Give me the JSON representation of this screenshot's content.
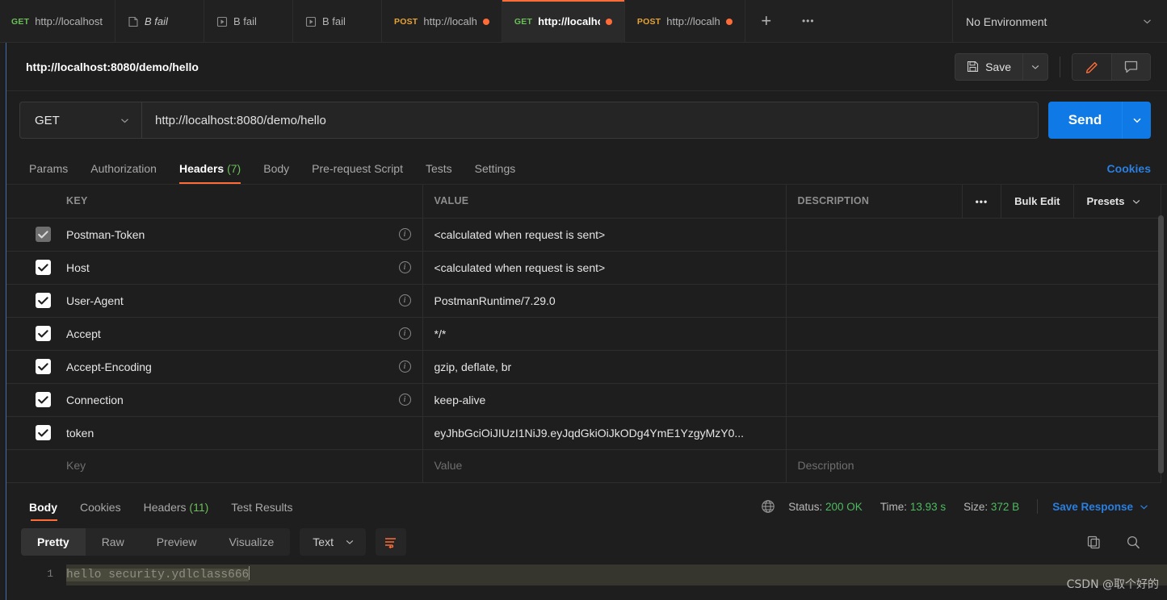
{
  "tabbar": {
    "tabs": [
      {
        "method": "GET",
        "method_class": "m-get",
        "label": "http://localhost",
        "icon": "",
        "dirty": false,
        "active": false,
        "italic": false
      },
      {
        "method": "",
        "method_class": "",
        "label": "B fail",
        "icon": "document-icon",
        "dirty": false,
        "active": false,
        "italic": true
      },
      {
        "method": "",
        "method_class": "",
        "label": "B fail",
        "icon": "runner-icon",
        "dirty": false,
        "active": false,
        "italic": false
      },
      {
        "method": "",
        "method_class": "",
        "label": "B fail",
        "icon": "runner-icon",
        "dirty": false,
        "active": false,
        "italic": false
      },
      {
        "method": "POST",
        "method_class": "m-post",
        "label": "http://localh",
        "icon": "",
        "dirty": true,
        "active": false,
        "italic": false
      },
      {
        "method": "GET",
        "method_class": "m-get",
        "label": "http://localho",
        "icon": "",
        "dirty": true,
        "active": true,
        "italic": false
      },
      {
        "method": "POST",
        "method_class": "m-post",
        "label": "http://localh",
        "icon": "",
        "dirty": true,
        "active": false,
        "italic": false
      }
    ],
    "new_tab_label": "+",
    "more_label": "•••",
    "environment": "No Environment"
  },
  "request": {
    "title": "http://localhost:8080/demo/hello",
    "save_label": "Save",
    "method": "GET",
    "url": "http://localhost:8080/demo/hello",
    "send_label": "Send"
  },
  "request_tabs": [
    {
      "label": "Params",
      "count": "",
      "active": false
    },
    {
      "label": "Authorization",
      "count": "",
      "active": false
    },
    {
      "label": "Headers",
      "count": "(7)",
      "active": true
    },
    {
      "label": "Body",
      "count": "",
      "active": false
    },
    {
      "label": "Pre-request Script",
      "count": "",
      "active": false
    },
    {
      "label": "Tests",
      "count": "",
      "active": false
    },
    {
      "label": "Settings",
      "count": "",
      "active": false
    }
  ],
  "cookies_link": "Cookies",
  "headers_table": {
    "columns": [
      "KEY",
      "VALUE",
      "DESCRIPTION"
    ],
    "actions": {
      "more": "•••",
      "bulk_edit": "Bulk Edit",
      "presets": "Presets"
    },
    "rows": [
      {
        "checked": true,
        "disabled": true,
        "key": "Postman-Token",
        "info": true,
        "value": "<calculated when request is sent>",
        "description": ""
      },
      {
        "checked": true,
        "disabled": false,
        "key": "Host",
        "info": true,
        "value": "<calculated when request is sent>",
        "description": ""
      },
      {
        "checked": true,
        "disabled": false,
        "key": "User-Agent",
        "info": true,
        "value": "PostmanRuntime/7.29.0",
        "description": ""
      },
      {
        "checked": true,
        "disabled": false,
        "key": "Accept",
        "info": true,
        "value": "*/*",
        "description": ""
      },
      {
        "checked": true,
        "disabled": false,
        "key": "Accept-Encoding",
        "info": true,
        "value": "gzip, deflate, br",
        "description": ""
      },
      {
        "checked": true,
        "disabled": false,
        "key": "Connection",
        "info": true,
        "value": "keep-alive",
        "description": ""
      },
      {
        "checked": true,
        "disabled": false,
        "key": "token",
        "info": false,
        "value": "eyJhbGciOiJIUzI1NiJ9.eyJqdGkiOiJkODg4YmE1YzgyMzY0...",
        "description": ""
      }
    ],
    "new_row": {
      "key_placeholder": "Key",
      "value_placeholder": "Value",
      "description_placeholder": "Description"
    }
  },
  "response_tabs": [
    {
      "label": "Body",
      "count": "",
      "active": true
    },
    {
      "label": "Cookies",
      "count": "",
      "active": false
    },
    {
      "label": "Headers",
      "count": "(11)",
      "active": false
    },
    {
      "label": "Test Results",
      "count": "",
      "active": false
    }
  ],
  "response_status": {
    "status_label": "Status:",
    "status_value": "200 OK",
    "time_label": "Time:",
    "time_value": "13.93 s",
    "size_label": "Size:",
    "size_value": "372 B",
    "save_response": "Save Response"
  },
  "body_toolbar": {
    "views": [
      {
        "label": "Pretty",
        "active": true
      },
      {
        "label": "Raw",
        "active": false
      },
      {
        "label": "Preview",
        "active": false
      },
      {
        "label": "Visualize",
        "active": false
      }
    ],
    "format": "Text"
  },
  "response_body": {
    "line_number": "1",
    "text": "hello security.ydlclass666"
  },
  "watermark": "CSDN @取个好的",
  "colors": {
    "accent_orange": "#ff6c37",
    "send_blue": "#0f7ae5",
    "link_blue": "#2a7fe0",
    "status_green": "#4dbb5f",
    "get_green": "#6bbf59",
    "post_orange": "#e6a336",
    "background": "#1e1e1e"
  }
}
